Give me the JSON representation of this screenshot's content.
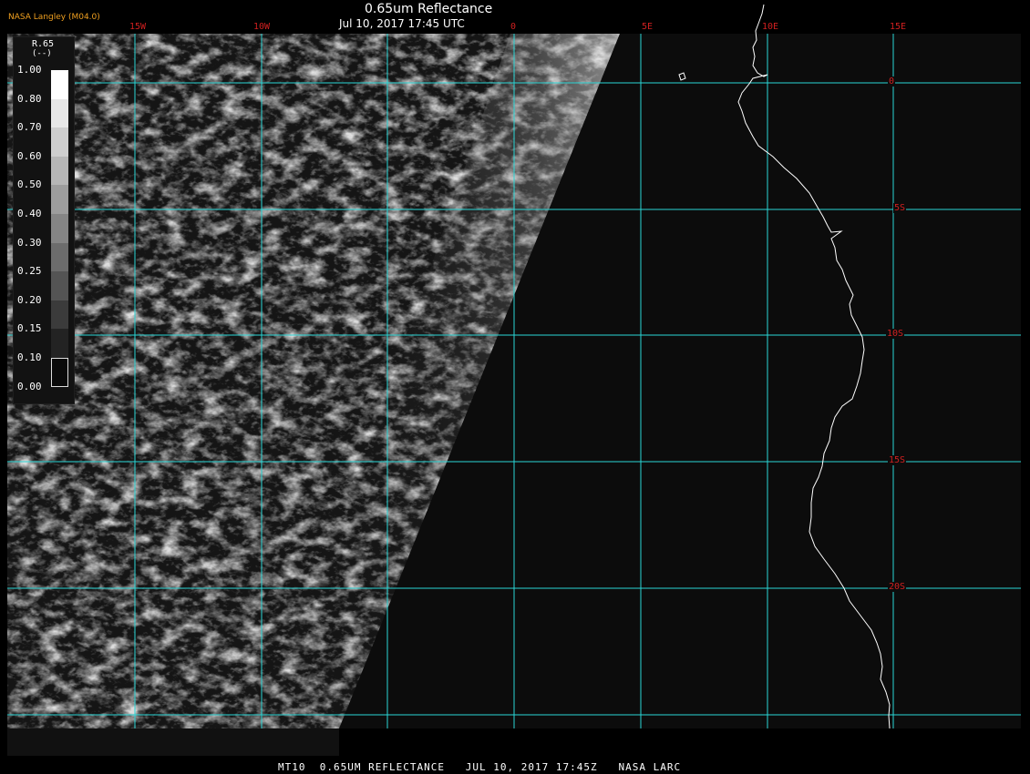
{
  "header": {
    "org_label": "NASA Langley (M04.0)",
    "title": "0.65um Reflectance",
    "subtitle": "Jul 10, 2017 17:45 UTC"
  },
  "grid": {
    "lon_labels": [
      "15W",
      "10W",
      "0",
      "5E",
      "10E",
      "15E"
    ],
    "lat_labels": [
      "0",
      "5S",
      "10S",
      "15S",
      "20S"
    ]
  },
  "legend": {
    "title": "R.65",
    "units": "(--)",
    "unit_char": "(%)",
    "ticks": [
      "1.00",
      "0.80",
      "0.70",
      "0.60",
      "0.50",
      "0.40",
      "0.30",
      "0.25",
      "0.20",
      "0.15",
      "0.10",
      "0.00"
    ]
  },
  "footer": "MT10  0.65UM REFLECTANCE   JUL 10, 2017 17:45Z   NASA LARC",
  "colors": {
    "gridline": "#2ad6d6",
    "label_red": "#d02020",
    "coastline": "#ffffff",
    "background": "#0c0c0c"
  }
}
